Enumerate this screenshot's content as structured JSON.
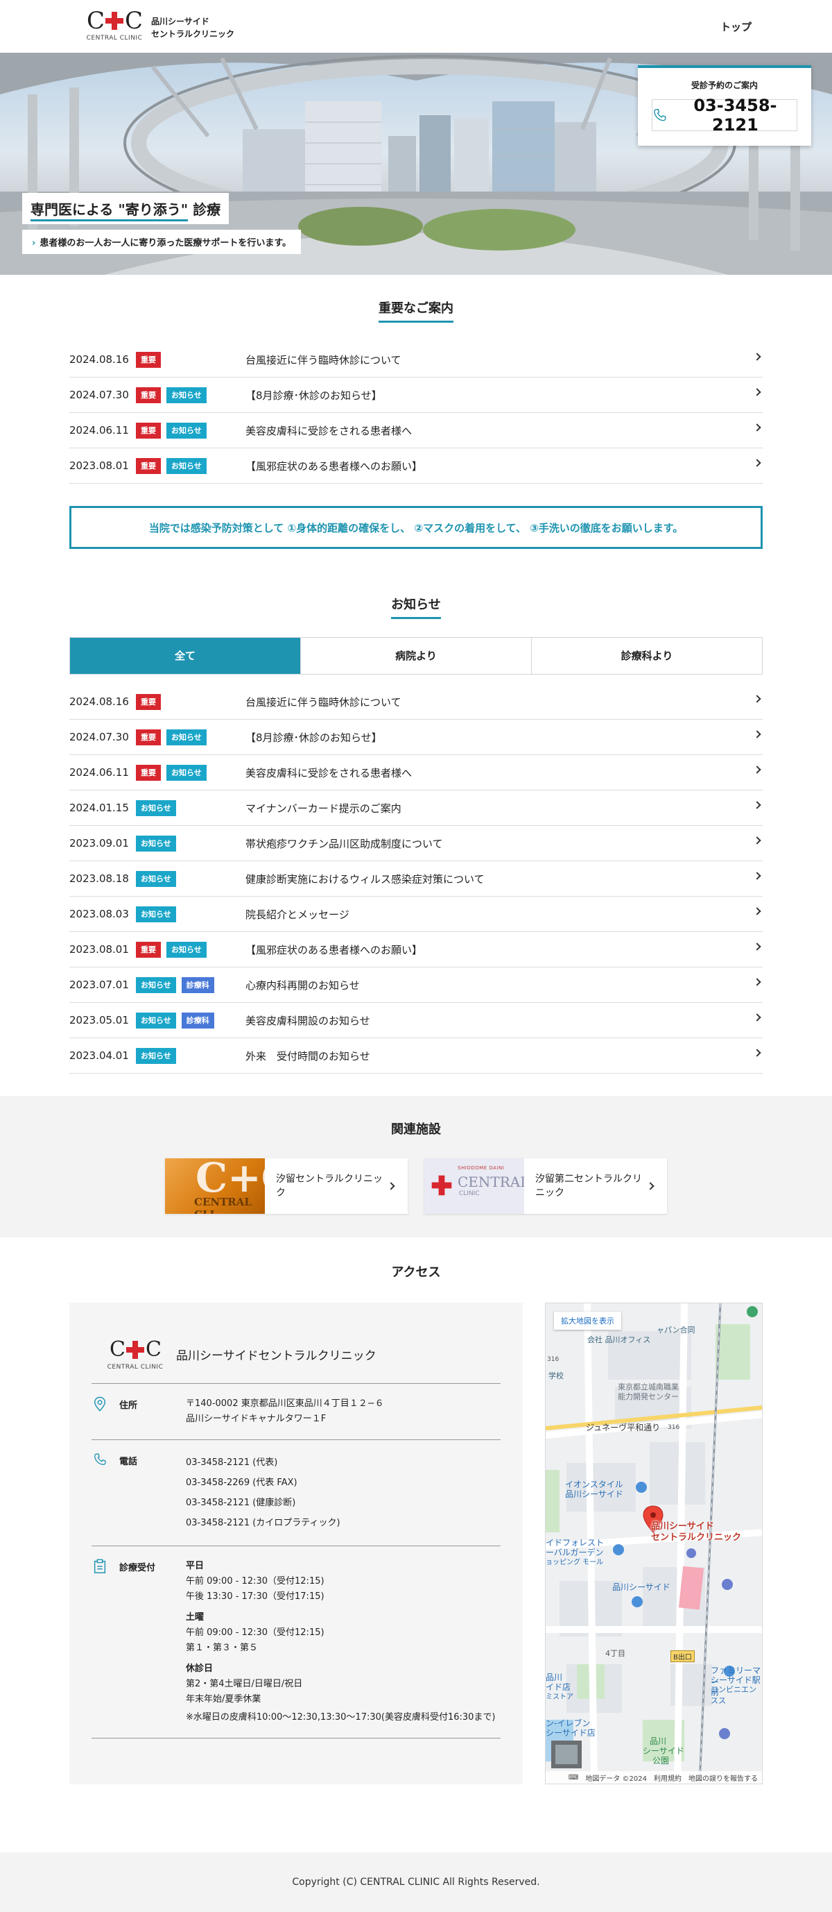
{
  "header": {
    "logo_letters_left": "C",
    "logo_letters_right": "C",
    "logo_sub": "CENTRAL CLINIC",
    "logo_name_line1": "品川シーサイド",
    "logo_name_line2": "セントラルクリニック",
    "nav_top": "トップ"
  },
  "hero": {
    "title_prefix": "専門医による",
    "title_highlight": "\"寄り添う\"",
    "title_suffix": "診療",
    "subtitle": "患者様のお一人お一人に寄り添った医療サポートを行います。",
    "reserve_label": "受診予約のご案内",
    "reserve_phone": "03-3458-2121"
  },
  "important": {
    "title": "重要なご案内",
    "items": [
      {
        "date": "2024.08.16",
        "badges": [
          "重要"
        ],
        "title": "台風接近に伴う臨時休診について"
      },
      {
        "date": "2024.07.30",
        "badges": [
          "重要",
          "お知らせ"
        ],
        "title": "【8月診療･休診のお知らせ】"
      },
      {
        "date": "2024.06.11",
        "badges": [
          "重要",
          "お知らせ"
        ],
        "title": "美容皮膚科に受診をされる患者様へ"
      },
      {
        "date": "2023.08.01",
        "badges": [
          "重要",
          "お知らせ"
        ],
        "title": "【風邪症状のある患者様へのお願い】"
      }
    ]
  },
  "notice": "当院では感染予防対策として ①身体的距離の確保をし、 ②マスクの着用をして、 ③手洗いの徹底をお願いします。",
  "news": {
    "title": "お知らせ",
    "tabs": [
      "全て",
      "病院より",
      "診療科より"
    ],
    "items": [
      {
        "date": "2024.08.16",
        "badges": [
          "重要"
        ],
        "title": "台風接近に伴う臨時休診について"
      },
      {
        "date": "2024.07.30",
        "badges": [
          "重要",
          "お知らせ"
        ],
        "title": "【8月診療･休診のお知らせ】"
      },
      {
        "date": "2024.06.11",
        "badges": [
          "重要",
          "お知らせ"
        ],
        "title": "美容皮膚科に受診をされる患者様へ"
      },
      {
        "date": "2024.01.15",
        "badges": [
          "お知らせ"
        ],
        "title": "マイナンバーカード提示のご案内"
      },
      {
        "date": "2023.09.01",
        "badges": [
          "お知らせ"
        ],
        "title": "帯状疱疹ワクチン品川区助成制度について"
      },
      {
        "date": "2023.08.18",
        "badges": [
          "お知らせ"
        ],
        "title": "健康診断実施におけるウィルス感染症対策について"
      },
      {
        "date": "2023.08.03",
        "badges": [
          "お知らせ"
        ],
        "title": "院長紹介とメッセージ"
      },
      {
        "date": "2023.08.01",
        "badges": [
          "重要",
          "お知らせ"
        ],
        "title": "【風邪症状のある患者様へのお願い】"
      },
      {
        "date": "2023.07.01",
        "badges": [
          "お知らせ",
          "診療科"
        ],
        "title": "心療内科再開のお知らせ"
      },
      {
        "date": "2023.05.01",
        "badges": [
          "お知らせ",
          "診療科"
        ],
        "title": "美容皮膚科開設のお知らせ"
      },
      {
        "date": "2023.04.01",
        "badges": [
          "お知らせ"
        ],
        "title": "外来　受付時間のお知らせ"
      }
    ]
  },
  "related": {
    "title": "関連施設",
    "cards": [
      {
        "name": "汐留セントラルクリニック",
        "thumb_text": "CENTRAL CLI"
      },
      {
        "name": "汐留第二セントラルクリニック",
        "thumb_text": "CENTRAL",
        "thumb_top": "SHIODOME DAINI",
        "thumb_sub": "CLINIC"
      }
    ]
  },
  "access": {
    "title": "アクセス",
    "clinic_name": "品川シーサイドセントラルクリニック",
    "address_label": "住所",
    "address_lines": [
      "〒140-0002 東京都品川区東品川４丁目１２−６",
      "品川シーサイドキャナルタワー１F"
    ],
    "phone_label": "電話",
    "phone_lines": [
      "03-3458-2121 (代表)",
      "03-3458-2269 (代表 FAX)",
      "03-3458-2121 (健康診断)",
      "03-3458-2121 (カイロプラティック)"
    ],
    "hours_label": "診療受付",
    "weekday_head": "平日",
    "weekday_am": "午前 09:00 - 12:30（受付12:15)",
    "weekday_pm": "午後 13:30 - 17:30（受付17:15)",
    "saturday_head": "土曜",
    "saturday_am": "午前 09:00 - 12:30（受付12:15)",
    "saturday_weeks": "第１・第３・第５",
    "closed_head": "休診日",
    "closed_line1": "第2・第4土曜日/日曜日/祝日",
    "closed_line2": "年末年始/夏季休業",
    "wednesday_note": "※水曜日の皮膚科10:00〜12:30,13:30〜17:30(美容皮膚科受付16:30まで)"
  },
  "map": {
    "expand": "拡大地図を表示",
    "clinic_line1": "品川シーサイド",
    "clinic_line2": "セントラルクリニック",
    "labels": {
      "a": "ャパン合同",
      "b": "会社 品川オフィス",
      "c": "学校",
      "d": "東京都立城南職業",
      "e": "能力開発センター",
      "f": "ジュネーヴ平和通り",
      "g": "イオンスタイル",
      "h": "品川シーサイド",
      "i": "イドフォレスト",
      "j": "ーバルガーデン",
      "k": "ョッピング モール",
      "l": "品川シーサイド",
      "m": "4丁目",
      "n": "B出口",
      "o": "ファミリーマー",
      "p": "シーサイド駅前",
      "q": "コンビニエンスス",
      "r": "ン-イレブン",
      "s": "シーサイド店",
      "t": "品川",
      "u": "シーサイド",
      "v": "公園",
      "w": "品川",
      "x": "イド店",
      "y": "ミストア",
      "z": "316",
      "aa": "316"
    },
    "footer_data": "地図データ ©2024",
    "footer_terms": "利用規約",
    "footer_report": "地図の誤りを報告する"
  },
  "footer": {
    "copyright": "Copyright (C) CENTRAL CLINIC All Rights Reserved."
  },
  "colors": {
    "accent": "#1f94b1",
    "important": "#d7262e",
    "news": "#1aa6c9",
    "dept": "#4878d8"
  }
}
